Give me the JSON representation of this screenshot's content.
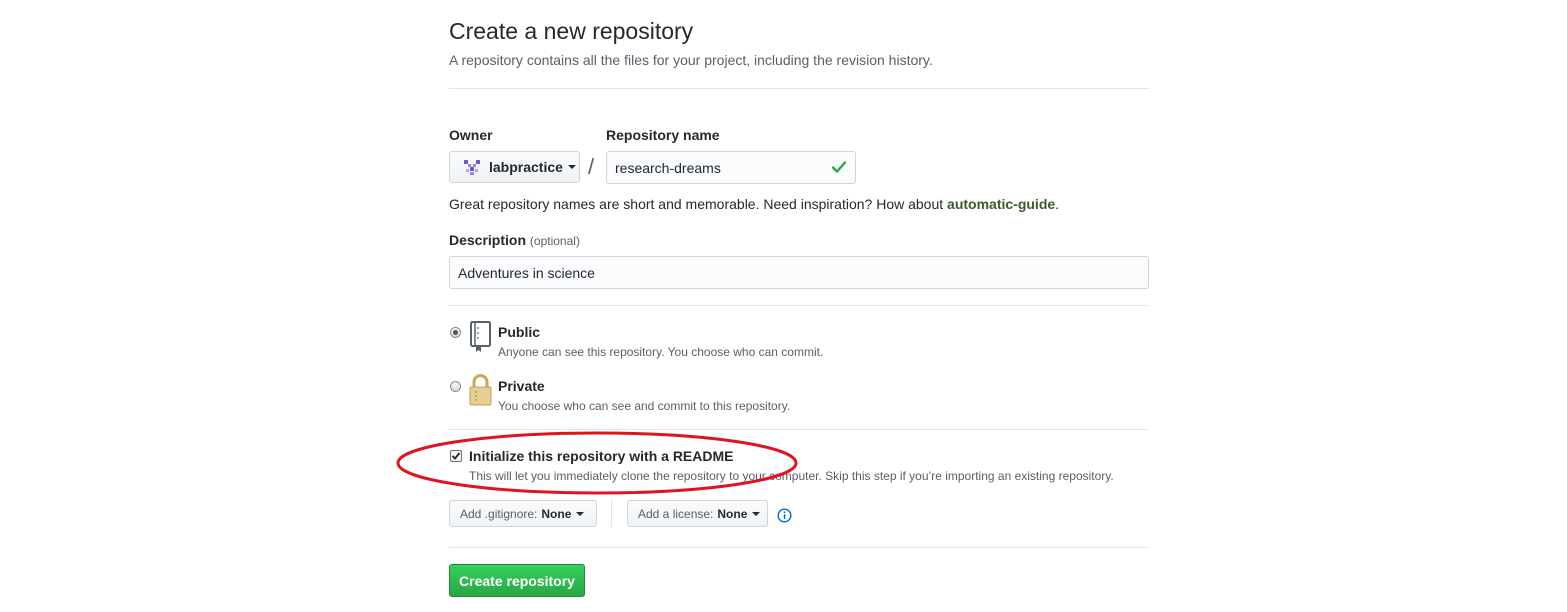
{
  "header": {
    "title": "Create a new repository",
    "subtitle": "A repository contains all the files for your project, including the revision history."
  },
  "owner": {
    "label": "Owner",
    "value": "labpractice"
  },
  "repository_name": {
    "label": "Repository name",
    "value": "research-dreams",
    "separator": "/"
  },
  "name_hint": {
    "text": "Great repository names are short and memorable. Need inspiration? How about ",
    "suggestion": "automatic-guide",
    "suffix": "."
  },
  "description": {
    "label": "Description",
    "optional": "(optional)",
    "value": "Adventures in science"
  },
  "visibility": {
    "public": {
      "title": "Public",
      "note": "Anyone can see this repository. You choose who can commit.",
      "selected": true
    },
    "private": {
      "title": "Private",
      "note": "You choose who can see and commit to this repository.",
      "selected": false
    }
  },
  "readme": {
    "title": "Initialize this repository with a README",
    "note": "This will let you immediately clone the repository to your computer. Skip this step if you’re importing an existing repository.",
    "checked": true
  },
  "gitignore": {
    "label": "Add .gitignore:",
    "value": "None"
  },
  "license": {
    "label": "Add a license:",
    "value": "None"
  },
  "submit": {
    "label": "Create repository"
  },
  "colors": {
    "annotation": "#e0141e",
    "primary_button": "#28a745",
    "valid_check": "#28a745",
    "info_icon": "#0366d6"
  },
  "icons": [
    "owner-avatar-icon",
    "caret-down-icon",
    "check-icon",
    "repo-book-icon",
    "lock-icon",
    "info-icon"
  ]
}
